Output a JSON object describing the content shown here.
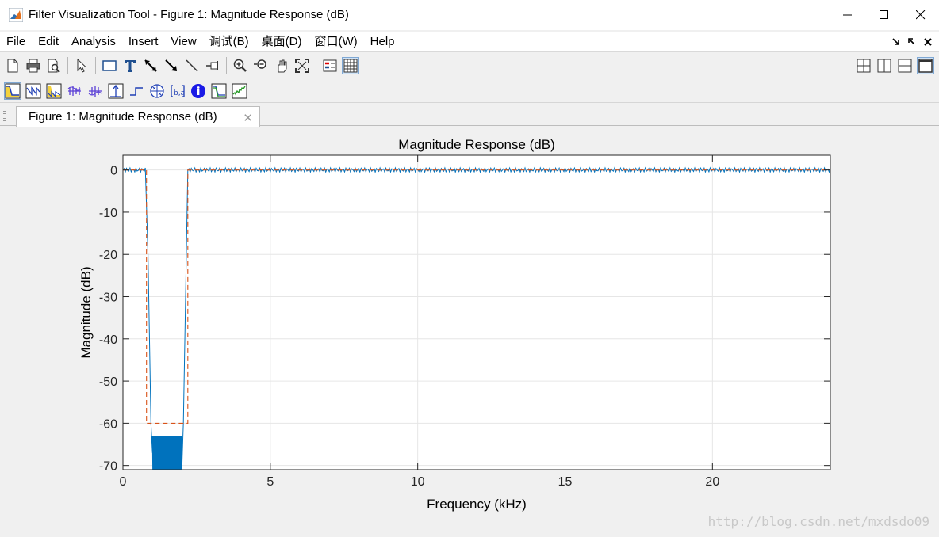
{
  "window": {
    "title": "Filter Visualization Tool - Figure 1: Magnitude Response (dB)"
  },
  "menubar": {
    "items": [
      {
        "label": "File",
        "name": "menu-file"
      },
      {
        "label": "Edit",
        "name": "menu-edit"
      },
      {
        "label": "Analysis",
        "name": "menu-analysis"
      },
      {
        "label": "Insert",
        "name": "menu-insert"
      },
      {
        "label": "View",
        "name": "menu-view"
      },
      {
        "label": "调试(B)",
        "name": "menu-debug"
      },
      {
        "label": "桌面(D)",
        "name": "menu-desktop"
      },
      {
        "label": "窗口(W)",
        "name": "menu-window"
      },
      {
        "label": "Help",
        "name": "menu-help"
      }
    ],
    "right_icons": [
      "undock-icon",
      "dock-icon",
      "close-figure-icon"
    ]
  },
  "tab": {
    "label": "Figure 1: Magnitude Response (dB)"
  },
  "watermark": "http://blog.csdn.net/mxdsdo09",
  "colors": {
    "response": "#0072bd",
    "mask": "#d95319",
    "grid": "#e6e6e6"
  },
  "chart_data": {
    "type": "line",
    "title": "Magnitude Response (dB)",
    "xlabel": "Frequency (kHz)",
    "ylabel": "Magnitude (dB)",
    "xlim": [
      0,
      24
    ],
    "ylim": [
      -71,
      3.5
    ],
    "xticks": [
      0,
      5,
      10,
      15,
      20
    ],
    "yticks": [
      0,
      -10,
      -20,
      -30,
      -40,
      -50,
      -60,
      -70
    ],
    "grid": true,
    "series": [
      {
        "style": "solid",
        "color": "#0072bd",
        "x": [
          0,
          0.8,
          0.85,
          0.95,
          1.0,
          2.0,
          2.05,
          2.15,
          2.2,
          24
        ],
        "y": [
          0,
          0,
          -20,
          -60,
          -65,
          -65,
          -60,
          -20,
          0,
          0
        ],
        "stopband_ripple_db": [
          -63,
          -71
        ],
        "passband_ripple_db": [
          -0.5,
          0.5
        ]
      },
      {
        "style": "dashed",
        "color": "#d95319",
        "x": [
          0,
          0.8,
          0.8,
          2.2,
          2.2,
          24
        ],
        "y": [
          0,
          0,
          -60,
          -60,
          0,
          0
        ]
      }
    ]
  }
}
